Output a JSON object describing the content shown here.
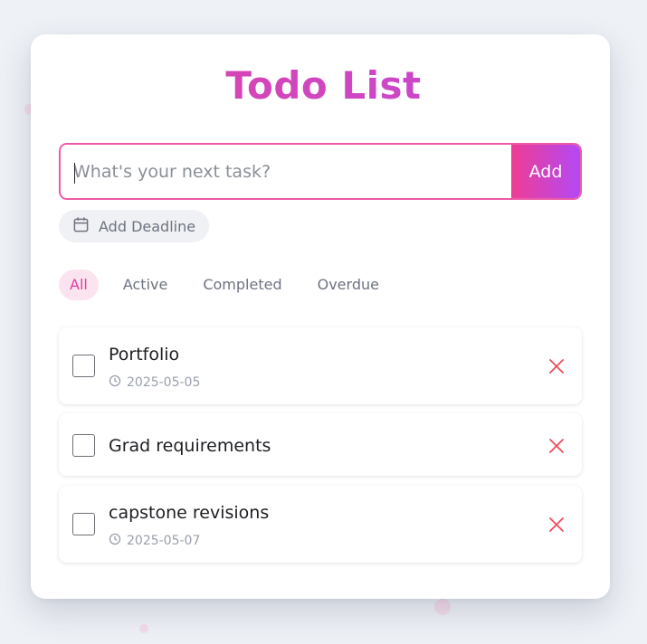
{
  "app": {
    "title": "Todo List"
  },
  "input": {
    "placeholder": "What's your next task?",
    "value": ""
  },
  "add_button": {
    "label": "Add"
  },
  "deadline_button": {
    "label": "Add Deadline",
    "icon": "calendar-icon"
  },
  "filters": [
    {
      "label": "All",
      "active": true
    },
    {
      "label": "Active",
      "active": false
    },
    {
      "label": "Completed",
      "active": false
    },
    {
      "label": "Overdue",
      "active": false
    }
  ],
  "todos": [
    {
      "text": "Portfolio",
      "date": "2025-05-05",
      "completed": false
    },
    {
      "text": "Grad requirements",
      "date": "",
      "completed": false
    },
    {
      "text": "capstone revisions",
      "date": "2025-05-07",
      "completed": false
    }
  ],
  "colors": {
    "accent_pink": "#e0429f",
    "accent_purple": "#b349f5",
    "delete_red": "#ef4b5b",
    "background": "#eef1f6"
  }
}
